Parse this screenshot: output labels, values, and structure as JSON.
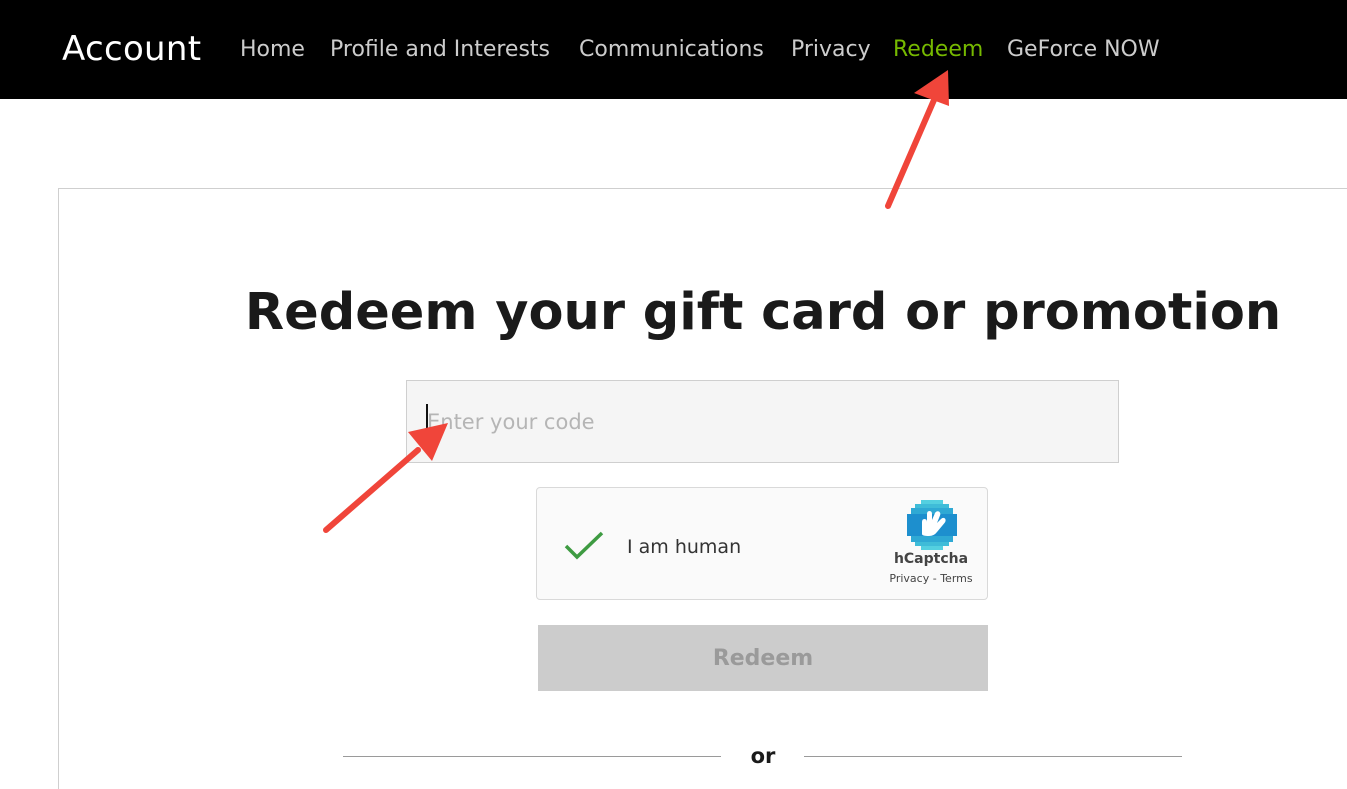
{
  "header": {
    "brand": "Account",
    "nav": [
      {
        "label": "Home",
        "active": false
      },
      {
        "label": "Profile and Interests",
        "active": false
      },
      {
        "label": "Communications",
        "active": false
      },
      {
        "label": "Privacy",
        "active": false
      },
      {
        "label": "Redeem",
        "active": true
      },
      {
        "label": "GeForce NOW",
        "active": false
      }
    ]
  },
  "main": {
    "title": "Redeem your gift card or promotion",
    "code_input": {
      "placeholder": "Enter your code",
      "value": ""
    },
    "captcha": {
      "label": "I am human",
      "provider": "hCaptcha",
      "links": "Privacy - Terms",
      "checked": true
    },
    "redeem_button": "Redeem",
    "or_label": "or"
  },
  "colors": {
    "accent": "#76b900",
    "annotation_arrow": "#f0453a",
    "button_disabled": "#cccccc"
  },
  "icons": {
    "check": "check-icon",
    "hcaptcha": "hcaptcha-logo-icon"
  }
}
